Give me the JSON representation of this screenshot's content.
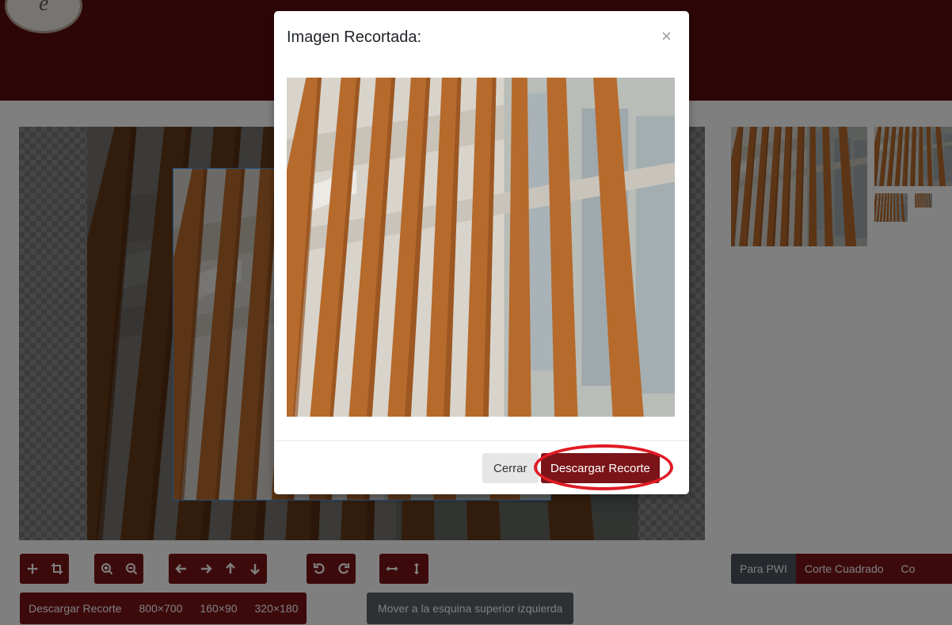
{
  "modal": {
    "title": "Imagen Recortada:",
    "close_glyph": "×",
    "close_label": "Cerrar",
    "download_label": "Descargar Recorte"
  },
  "toolbar": {
    "move_icon": "move-arrows-icon",
    "crop_icon": "crop-icon",
    "zoom_in_icon": "zoom-in-icon",
    "zoom_out_icon": "zoom-out-icon",
    "left_icon": "arrow-left-icon",
    "right_icon": "arrow-right-icon",
    "up_icon": "arrow-up-icon",
    "down_icon": "arrow-down-icon",
    "rotate_left_icon": "rotate-left-icon",
    "rotate_right_icon": "rotate-right-icon",
    "flip_h_icon": "flip-horizontal-icon",
    "flip_v_icon": "flip-vertical-icon"
  },
  "download_group": {
    "download_label": "Descargar Recorte",
    "sizes": [
      "800×700",
      "160×90",
      "320×180"
    ]
  },
  "move_corner_label": "Mover a la esquina superior izquierda",
  "modes": [
    "Para PWI",
    "Corte Cuadrado",
    "Co"
  ],
  "colors": {
    "brand": "#7a1418",
    "header": "#5a0c0e",
    "highlight": "#e01b24",
    "active_mode": "#4d555c"
  },
  "logo_letter": "e"
}
